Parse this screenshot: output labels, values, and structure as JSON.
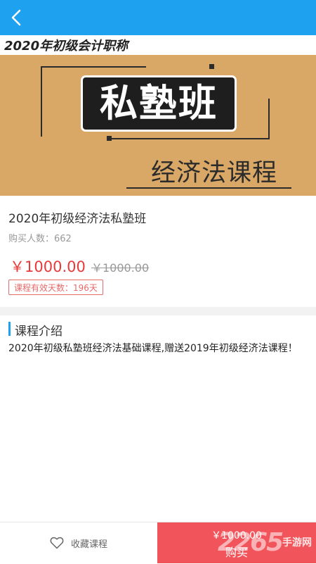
{
  "header": {
    "back_icon": "chevron-left-icon",
    "bg_color": "#1ea2f0"
  },
  "banner": {
    "top_text": "2020年初级会计职称",
    "title": "私塾班",
    "subtitle": "经济法课程"
  },
  "course": {
    "title": "2020年初级经济法私塾班",
    "buyers": "购买人数：662",
    "price": "￥1000.00",
    "original_price": "￥1000.00",
    "valid_days": "课程有效天数：196天"
  },
  "intro": {
    "heading": "课程介绍",
    "text": "2020年初级私塾班经济法基础课程,赠送2019年初级经济法课程！"
  },
  "footer": {
    "favorite_label": "收藏课程",
    "favorite_icon": "heart-icon",
    "buy_price": "￥1000.00",
    "buy_label": "购买",
    "buy_color": "#f2545b"
  },
  "watermark": {
    "number": "2265",
    "brand": "手游网"
  }
}
